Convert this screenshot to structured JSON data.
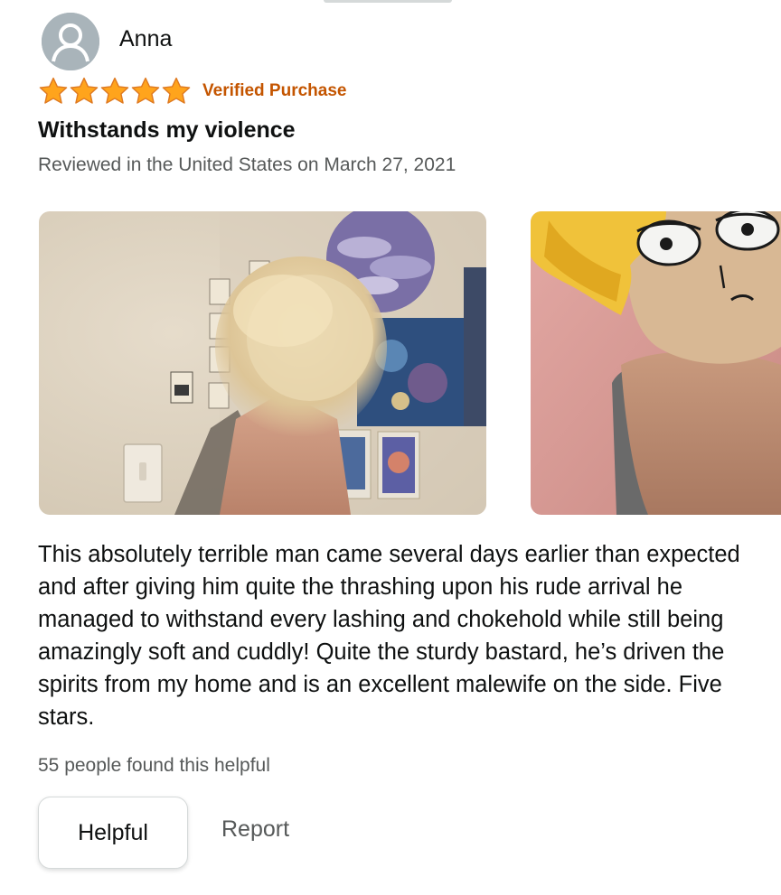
{
  "review": {
    "reviewer_name": "Anna",
    "rating": 5,
    "rating_max": 5,
    "verified_label": "Verified Purchase",
    "title": "Withstands my violence",
    "date_text": "Reviewed in the United States on March 27, 2021",
    "body": "This absolutely terrible man came several days earlier than expected and after giving him quite the thrashing upon his rude arrival he managed to withstand every lashing and chokehold while still being amazingly soft and cuddly! Quite the sturdy bastard, he’s driven the spirits from my home and is an excellent malewife on the side. Five stars.",
    "helpful_count_text": "55 people found this helpful"
  },
  "actions": {
    "helpful_label": "Helpful",
    "report_label": "Report"
  },
  "colors": {
    "star": "#ffa41c",
    "verified": "#c45500",
    "secondary_text": "#565959",
    "primary_text": "#0f1111"
  },
  "icons": {
    "avatar": "default-user-avatar-icon",
    "star": "star-filled-icon"
  }
}
